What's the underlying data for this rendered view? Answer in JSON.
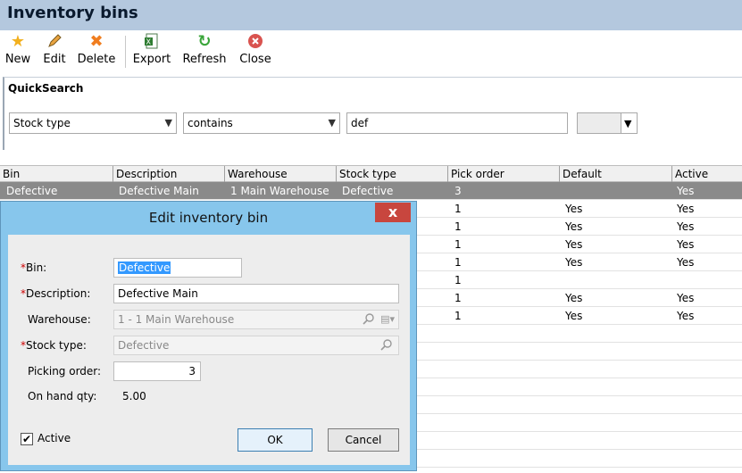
{
  "window": {
    "title": "Inventory bins"
  },
  "toolbar": {
    "new_label": "New",
    "edit_label": "Edit",
    "delete_label": "Delete",
    "export_label": "Export",
    "refresh_label": "Refresh",
    "close_label": "Close"
  },
  "quicksearch": {
    "title": "QuickSearch",
    "field": "Stock type",
    "operator": "contains",
    "value": "def"
  },
  "grid": {
    "columns": [
      "Bin",
      "Description",
      "Warehouse",
      "Stock type",
      "Pick order",
      "Default",
      "Active"
    ],
    "rows": [
      {
        "bin": "Defective",
        "description": "Defective Main",
        "warehouse": "1 Main Warehouse",
        "stock_type": "Defective",
        "pick_order": "3",
        "default": "",
        "active": "Yes"
      },
      {
        "pick_order": "1",
        "default": "Yes",
        "active": "Yes"
      },
      {
        "pick_order": "1",
        "default": "Yes",
        "active": "Yes"
      },
      {
        "pick_order": "1",
        "default": "Yes",
        "active": "Yes"
      },
      {
        "pick_order": "1",
        "default": "Yes",
        "active": "Yes"
      },
      {
        "pick_order": "1",
        "default": "",
        "active": ""
      },
      {
        "pick_order": "1",
        "default": "Yes",
        "active": "Yes"
      },
      {
        "pick_order": "1",
        "default": "Yes",
        "active": "Yes"
      }
    ]
  },
  "dialog": {
    "title": "Edit inventory bin",
    "close_glyph": "x",
    "required_mark": "*",
    "bin_label": "Bin:",
    "bin_value": "Defective",
    "description_label": "Description:",
    "description_value": "Defective Main",
    "warehouse_label": "Warehouse:",
    "warehouse_value": "1 - 1 Main Warehouse",
    "stock_type_label": "Stock type:",
    "stock_type_value": "Defective",
    "picking_order_label": "Picking order:",
    "picking_order_value": "3",
    "onhand_label": "On hand qty:",
    "onhand_value": "5.00",
    "active_label": "Active",
    "active_checked": true,
    "ok_label": "OK",
    "cancel_label": "Cancel"
  },
  "colors": {
    "titlebar": "#b4c8de",
    "dialog_frame": "#87c6ec",
    "close_button": "#c8463e",
    "selected_row": "#8a8a8a"
  },
  "icons": [
    "star-icon",
    "pencil-icon",
    "delete-x-icon",
    "excel-export-icon",
    "refresh-icon",
    "close-circle-icon",
    "search-icon",
    "dropdown-icon"
  ]
}
